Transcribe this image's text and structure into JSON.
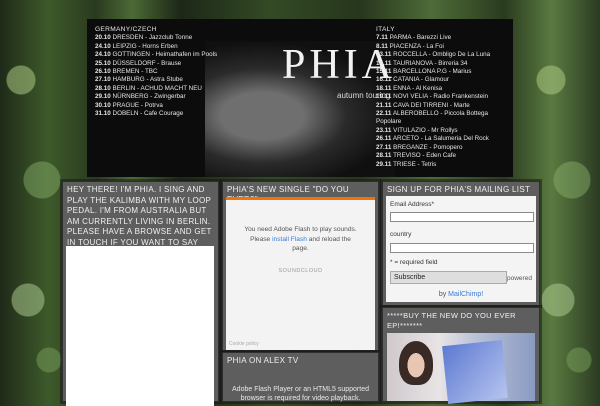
{
  "banner": {
    "band_name": "PHIA",
    "subtitle": "autumn touring",
    "left_heading": "GERMANY/CZECH",
    "left_dates": [
      {
        "date": "20.10",
        "venue": "DRESDEN - Jazzclub Tonne"
      },
      {
        "date": "24.10",
        "venue": "LEIPZIG - Horns Erben"
      },
      {
        "date": "24.10",
        "venue": "GOTTINGEN - Heimathafen im Pools"
      },
      {
        "date": "25.10",
        "venue": "DÜSSELDORF - Brause"
      },
      {
        "date": "26.10",
        "venue": "BREMEN - TBC"
      },
      {
        "date": "27.10",
        "venue": "HAMBURG - Astra Stube"
      },
      {
        "date": "28.10",
        "venue": "BERLIN - ACHUD MACHT NEU"
      },
      {
        "date": "29.10",
        "venue": "NÜRNBERG - Zwingerbar"
      },
      {
        "date": "30.10",
        "venue": "PRAGUE - Potrva"
      },
      {
        "date": "31.10",
        "venue": "DOBELN - Cafe Courage"
      }
    ],
    "right_heading": "ITALY",
    "right_dates": [
      {
        "date": "7.11",
        "venue": "PARMA - Barezzi Live"
      },
      {
        "date": "8.11",
        "venue": "PIACENZA - La Foi"
      },
      {
        "date": "13.11",
        "venue": "ROCCELLA - Ombligo De La Luna"
      },
      {
        "date": "14.11",
        "venue": "TAURIANOVA - Birreria 34"
      },
      {
        "date": "15.11",
        "venue": "BARCELLONA P.G - Marius"
      },
      {
        "date": "16.11",
        "venue": "CATANIA - Glamour"
      },
      {
        "date": "18.11",
        "venue": "ENNA - Al Kenisa"
      },
      {
        "date": "19.11",
        "venue": "NOVI VELIA - Radio Frankenstein"
      },
      {
        "date": "21.11",
        "venue": "CAVA DEI TIRRENI - Marte"
      },
      {
        "date": "22.11",
        "venue": "ALBEROBELLO - Piccola Bottega Popolare"
      },
      {
        "date": "23.11",
        "venue": "VITULAZIO - Mr Rollys"
      },
      {
        "date": "26.11",
        "venue": "ARCETO - La Salumeria Del Rock"
      },
      {
        "date": "27.11",
        "venue": "BREGANZE - Pomopero"
      },
      {
        "date": "28.11",
        "venue": "TREVISO - Eden Cafe"
      },
      {
        "date": "29.11",
        "venue": "TRIESE - Tetris"
      }
    ]
  },
  "intro": {
    "text": "HEY THERE! I'M PHIA. I SING AND PLAY THE KALIMBA WITH MY LOOP PEDAL. I'M FROM AUSTRALIA BUT AM CURRENTLY LIVING IN BERLIN. PLEASE HAVE A BROWSE AND GET IN TOUCH IF YOU WANT TO SAY HI!!"
  },
  "single": {
    "title": "PHIA'S NEW SINGLE \"DO YOU EVER?\"",
    "flash_line1": "You need Adobe Flash to play sounds. Please",
    "flash_link": "install Flash",
    "flash_line2": "and reload the page.",
    "provider": "SOUNDCLOUD",
    "cookie": "Cookie policy"
  },
  "alex": {
    "title": "PHIA ON ALEX TV",
    "flash_msg": "Adobe Flash Player or an HTML5 supported browser is required for video playback."
  },
  "mailing": {
    "title": "SIGN UP FOR PHIA'S MAILING LIST",
    "email_label": "Email Address*",
    "country_label": "country",
    "required_note": "* = required field",
    "subscribe_label": "Subscribe",
    "powered": "powered",
    "by": "by",
    "mailchimp": "MailChimp!"
  },
  "buy": {
    "title": "*****BUY THE NEW DO YOU EVER EP!*******"
  }
}
